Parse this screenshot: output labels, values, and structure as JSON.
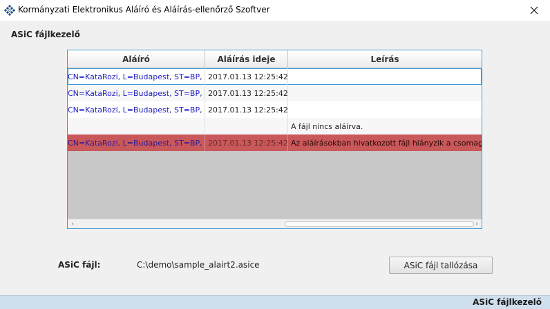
{
  "window": {
    "title": "Kormányzati Elektronikus Aláíró és Aláírás-ellenőrző Szoftver"
  },
  "section": {
    "title": "ASiC fájlkezelő"
  },
  "table": {
    "columns": [
      "Aláíró",
      "Aláírás ideje",
      "Leírás"
    ],
    "rows": [
      {
        "signer": "CN=KataRozi, L=Budapest, ST=BP, C=HU, EM...",
        "time": "2017.01.13 12:25:42",
        "description": "",
        "state": "selected"
      },
      {
        "signer": "CN=KataRozi, L=Budapest, ST=BP, C=HU, EM...",
        "time": "2017.01.13 12:25:42",
        "description": "",
        "state": "normal"
      },
      {
        "signer": "CN=KataRozi, L=Budapest, ST=BP, C=HU, EM...",
        "time": "2017.01.13 12:25:42",
        "description": "",
        "state": "normal"
      },
      {
        "signer": "",
        "time": "",
        "description": "A fájl nincs aláírva.",
        "state": "normal"
      },
      {
        "signer": "CN=KataRozi, L=Budapest, ST=BP, C=HU, EM...",
        "time": "2017.01.13 12:25:42",
        "description": "Az aláírásokban hivatkozott fájl hiányzik a csomagból.",
        "state": "error"
      }
    ]
  },
  "file": {
    "label": "ASiC fájl:",
    "path": "C:\\demo\\sample_alairt2.asice",
    "browse_label": "ASiC fájl tallózása"
  },
  "status": {
    "text": "ASiC fájlkezelő"
  },
  "colors": {
    "accent": "#3d9bd8",
    "error_row": "#c9585a",
    "status_bar": "#cfdfee",
    "signer_text": "#1d1dbf"
  },
  "icons": {
    "app": "app-logo-icon",
    "close": "close-icon",
    "scroll_left": "chevron-left-icon",
    "scroll_right": "chevron-right-icon"
  }
}
